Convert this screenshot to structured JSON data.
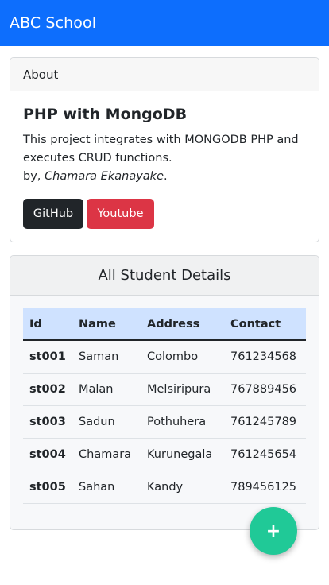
{
  "navbar": {
    "brand": "ABC School"
  },
  "about": {
    "header": "About",
    "title": "PHP with MongoDB",
    "description": "This project integrates with MONGODB PHP and executes CRUD functions.",
    "by_prefix": "by, ",
    "author": "Chamara Ekanayake",
    "by_suffix": ".",
    "github_label": "GitHub",
    "youtube_label": "Youtube"
  },
  "students": {
    "title": "All Student Details",
    "columns": [
      "Id",
      "Name",
      "Address",
      "Contact"
    ],
    "rows": [
      [
        "st001",
        "Saman",
        "Colombo",
        "761234568"
      ],
      [
        "st002",
        "Malan",
        "Melsiripura",
        "767889456"
      ],
      [
        "st003",
        "Sadun",
        "Pothuhera",
        "761245789"
      ],
      [
        "st004",
        "Chamara",
        "Kurunegala",
        "761245654"
      ],
      [
        "st005",
        "Sahan",
        "Kandy",
        "789456125"
      ]
    ]
  },
  "fab": {
    "label": "+",
    "color": "#20c997"
  },
  "colors": {
    "primary": "#0d6efd",
    "dark": "#212529",
    "danger": "#dc3545",
    "table_head": "#cfe2ff"
  }
}
